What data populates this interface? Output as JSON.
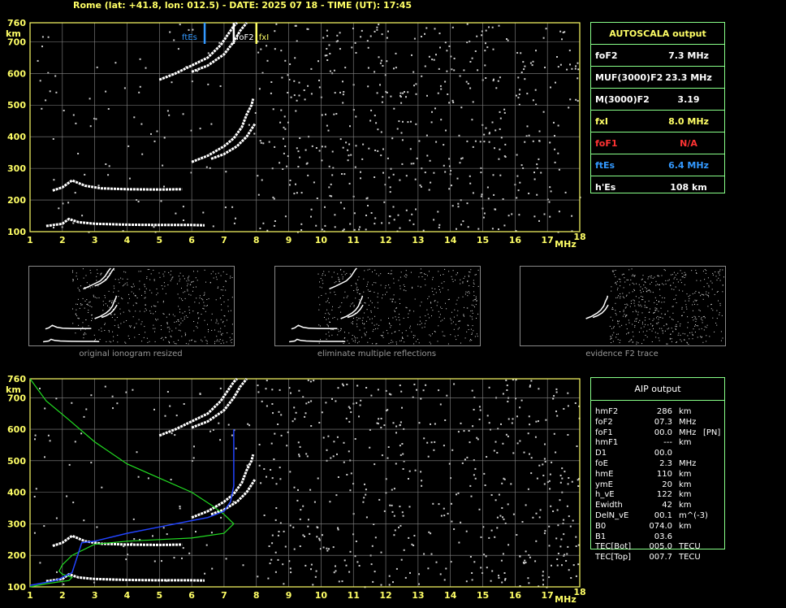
{
  "title": "Rome (lat: +41.8, lon: 012.5) - DATE: 2025 07 18 - TIME (UT): 17:45",
  "chart_data": [
    {
      "type": "scatter",
      "name_id": "ionogram-top",
      "xlabel": "MHz",
      "ylabel": "km",
      "xlim": [
        1,
        18
      ],
      "ylim": [
        100,
        760
      ],
      "xticks": [
        1,
        2,
        3,
        4,
        5,
        6,
        7,
        8,
        9,
        10,
        11,
        12,
        13,
        14,
        15,
        16,
        17,
        18
      ],
      "yticks": [
        100,
        200,
        300,
        400,
        500,
        600,
        700,
        760
      ],
      "grid": true,
      "markers": [
        {
          "label": "ftEs",
          "x": 6.4,
          "color": "#3399ff"
        },
        {
          "label": "foF2",
          "x": 7.3,
          "color": "#ffffff"
        },
        {
          "label": "fxI",
          "x": 8.0,
          "color": "#ffff66"
        }
      ],
      "traces": [
        {
          "name": "Es",
          "points": [
            [
              1.5,
              118
            ],
            [
              2.0,
              125
            ],
            [
              2.2,
              140
            ],
            [
              2.5,
              130
            ],
            [
              3.0,
              125
            ],
            [
              4.0,
              122
            ],
            [
              5.0,
              121
            ],
            [
              6.0,
              121
            ],
            [
              6.4,
              120
            ]
          ]
        },
        {
          "name": "E",
          "points": [
            [
              1.7,
              230
            ],
            [
              2.0,
              240
            ],
            [
              2.3,
              262
            ],
            [
              2.7,
              245
            ],
            [
              3.2,
              237
            ],
            [
              4.0,
              234
            ],
            [
              5.0,
              233
            ],
            [
              5.7,
              234
            ]
          ]
        },
        {
          "name": "F-o",
          "points": [
            [
              6.0,
              320
            ],
            [
              6.5,
              340
            ],
            [
              7.0,
              370
            ],
            [
              7.3,
              395
            ],
            [
              7.55,
              430
            ],
            [
              7.7,
              470
            ],
            [
              7.85,
              500
            ],
            [
              7.9,
              520
            ]
          ]
        },
        {
          "name": "F-x",
          "points": [
            [
              6.6,
              330
            ],
            [
              7.0,
              345
            ],
            [
              7.4,
              370
            ],
            [
              7.7,
              400
            ],
            [
              7.95,
              440
            ]
          ]
        },
        {
          "name": "F-2hop-o",
          "points": [
            [
              5.0,
              580
            ],
            [
              5.5,
              600
            ],
            [
              6.0,
              625
            ],
            [
              6.5,
              650
            ],
            [
              6.9,
              690
            ],
            [
              7.1,
              720
            ],
            [
              7.3,
              750
            ],
            [
              7.4,
              760
            ]
          ]
        },
        {
          "name": "F-2hop-x",
          "points": [
            [
              6.0,
              605
            ],
            [
              6.5,
              625
            ],
            [
              7.0,
              660
            ],
            [
              7.3,
              700
            ],
            [
              7.5,
              735
            ],
            [
              7.7,
              760
            ]
          ]
        }
      ]
    },
    {
      "type": "scatter",
      "name_id": "ionogram-aip",
      "xlabel": "MHz",
      "ylabel": "km",
      "xlim": [
        1,
        18
      ],
      "ylim": [
        100,
        760
      ],
      "xticks": [
        1,
        2,
        3,
        4,
        5,
        6,
        7,
        8,
        9,
        10,
        11,
        12,
        13,
        14,
        15,
        16,
        17,
        18
      ],
      "yticks": [
        100,
        200,
        300,
        400,
        500,
        600,
        700,
        760
      ],
      "grid": true,
      "profile_green": [
        [
          1.0,
          760
        ],
        [
          1.5,
          690
        ],
        [
          2.2,
          630
        ],
        [
          3.0,
          560
        ],
        [
          4.0,
          490
        ],
        [
          5.0,
          445
        ],
        [
          6.0,
          400
        ],
        [
          6.6,
          360
        ],
        [
          7.0,
          330
        ],
        [
          7.3,
          300
        ],
        [
          7.0,
          270
        ],
        [
          6.0,
          255
        ],
        [
          5.0,
          250
        ],
        [
          4.0,
          245
        ],
        [
          3.0,
          235
        ],
        [
          2.3,
          200
        ],
        [
          2.0,
          170
        ],
        [
          1.9,
          150
        ],
        [
          2.0,
          140
        ],
        [
          2.3,
          130
        ],
        [
          2.2,
          120
        ],
        [
          1.5,
          110
        ],
        [
          1.0,
          100
        ]
      ],
      "profile_blue": [
        [
          1.0,
          105
        ],
        [
          1.8,
          120
        ],
        [
          2.3,
          145
        ],
        [
          2.6,
          240
        ],
        [
          3.0,
          245
        ],
        [
          4.0,
          270
        ],
        [
          5.0,
          290
        ],
        [
          6.0,
          310
        ],
        [
          6.5,
          320
        ],
        [
          7.0,
          340
        ],
        [
          7.2,
          370
        ],
        [
          7.3,
          420
        ],
        [
          7.3,
          600
        ]
      ]
    }
  ],
  "autoscala": {
    "title": "AUTOSCALA output",
    "rows": [
      {
        "label": "foF2",
        "value": "7.3 MHz",
        "color": "#ffffff"
      },
      {
        "label": "MUF(3000)F2",
        "value": "23.3 MHz",
        "color": "#ffffff"
      },
      {
        "label": "M(3000)F2",
        "value": "3.19",
        "color": "#ffffff"
      },
      {
        "label": "fxI",
        "value": "8.0 MHz",
        "color": "#ffff66"
      },
      {
        "label": "foF1",
        "value": "N/A",
        "color": "#ff3333"
      },
      {
        "label": "ftEs",
        "value": "6.4 MHz",
        "color": "#3399ff"
      },
      {
        "label": "h'Es",
        "value": "108     km",
        "color": "#ffffff"
      }
    ]
  },
  "aip": {
    "title": "AIP output",
    "rows": [
      {
        "name": "hmF2",
        "value": "286",
        "unit": "km",
        "extra": ""
      },
      {
        "name": "foF2",
        "value": "07.3",
        "unit": "MHz",
        "extra": ""
      },
      {
        "name": "foF1",
        "value": "00.0",
        "unit": "MHz",
        "extra": "[PN]"
      },
      {
        "name": "hmF1",
        "value": "---",
        "unit": "km",
        "extra": ""
      },
      {
        "name": "D1",
        "value": "00.0",
        "unit": "",
        "extra": ""
      },
      {
        "name": "foE",
        "value": "2.3",
        "unit": "MHz",
        "extra": ""
      },
      {
        "name": "hmE",
        "value": "110",
        "unit": "km",
        "extra": ""
      },
      {
        "name": "ymE",
        "value": "20",
        "unit": "km",
        "extra": ""
      },
      {
        "name": "h_vE",
        "value": "122",
        "unit": "km",
        "extra": ""
      },
      {
        "name": "Ewidth",
        "value": "42",
        "unit": "km",
        "extra": ""
      },
      {
        "name": "DelN_vE",
        "value": "00.1",
        "unit": "m^(-3)",
        "extra": ""
      },
      {
        "name": "B0",
        "value": "074.0",
        "unit": "km",
        "extra": ""
      },
      {
        "name": "B1",
        "value": "03.6",
        "unit": "",
        "extra": ""
      },
      {
        "name": "TEC[Bot]",
        "value": "005.0",
        "unit": "TECU",
        "extra": ""
      },
      {
        "name": "TEC[Top]",
        "value": "007.7",
        "unit": "TECU",
        "extra": ""
      }
    ]
  },
  "thumbnails": [
    {
      "caption": "original ionogram resized",
      "stage": "original"
    },
    {
      "caption": "eliminate multiple reflections",
      "stage": "no-multiple"
    },
    {
      "caption": "evidence F2 trace",
      "stage": "f2"
    }
  ],
  "colors": {
    "axis": "#ffff66",
    "grid": "#888888",
    "profile_green": "#22dd22",
    "profile_blue": "#2244ff",
    "panel_border": "#88ff88"
  }
}
